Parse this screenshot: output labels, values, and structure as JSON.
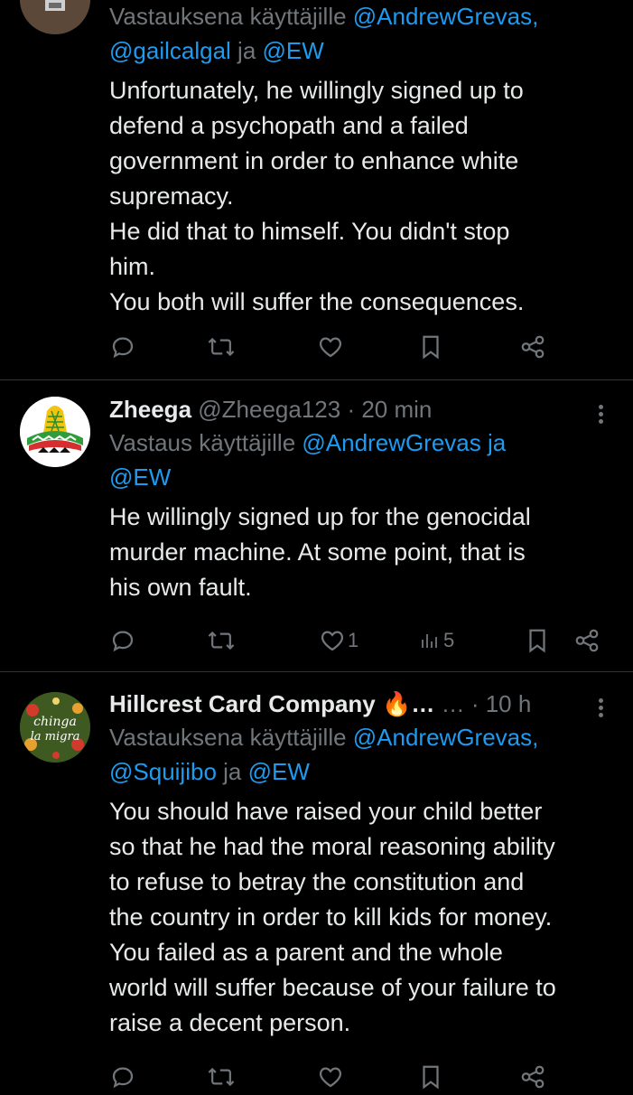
{
  "tweets": [
    {
      "reply_prefix": "Vastauksena käyttäjille ",
      "reply_mention1": "@AndrewGrevas,",
      "reply_mention2": "@gailcalgal",
      "reply_join": " ja ",
      "reply_mention3": "@EW",
      "body": [
        "Unfortunately, he willingly signed up to",
        "defend a psychopath and a failed",
        "government in order to enhance white",
        "supremacy.",
        "He did that to himself. You didn't stop",
        "him.",
        "You both will suffer the consequences."
      ],
      "icons": [
        "reply-icon",
        "retweet-icon",
        "like-icon",
        "bookmark-icon",
        "share-icon"
      ]
    },
    {
      "name": "Zheega",
      "handle": "@Zheega123",
      "separator": " · ",
      "time": "20 min",
      "reply_prefix": "Vastaus käyttäjille ",
      "reply_mention1": "@AndrewGrevas",
      "reply_join": " ja",
      "reply_mention2": "@EW",
      "body": [
        "He willingly signed up for the genocidal",
        "murder machine. At some point, that is",
        "his own fault."
      ],
      "like_count": "1",
      "views_count": "5",
      "icons": [
        "reply-icon",
        "retweet-icon",
        "like-icon",
        "views-icon",
        "bookmark-icon",
        "share-icon"
      ]
    },
    {
      "name": "Hillcrest Card Company",
      "name_suffix": "🔥…",
      "handle_truncated": "…",
      "separator": " · ",
      "time": "10 h",
      "avatar_text_line1": "chinga",
      "avatar_text_line2": "la migra",
      "reply_prefix": "Vastauksena käyttäjille ",
      "reply_mention1": "@AndrewGrevas,",
      "reply_mention2": "@Squijibo",
      "reply_join": " ja ",
      "reply_mention3": "@EW",
      "body": [
        "You should have raised your child better",
        "so that he had the moral reasoning ability",
        "to refuse to betray the constitution and",
        "the country in order to kill kids for money.",
        "You failed as a parent and the whole",
        "world will suffer because of your failure to",
        "raise a decent person."
      ],
      "icons": [
        "reply-icon",
        "retweet-icon",
        "like-icon",
        "bookmark-icon",
        "share-icon"
      ]
    }
  ],
  "colors": {
    "background": "#000000",
    "text": "#e7e9ea",
    "muted": "#71767b",
    "mention": "#1d9bf0",
    "divider": "#2f3336"
  }
}
